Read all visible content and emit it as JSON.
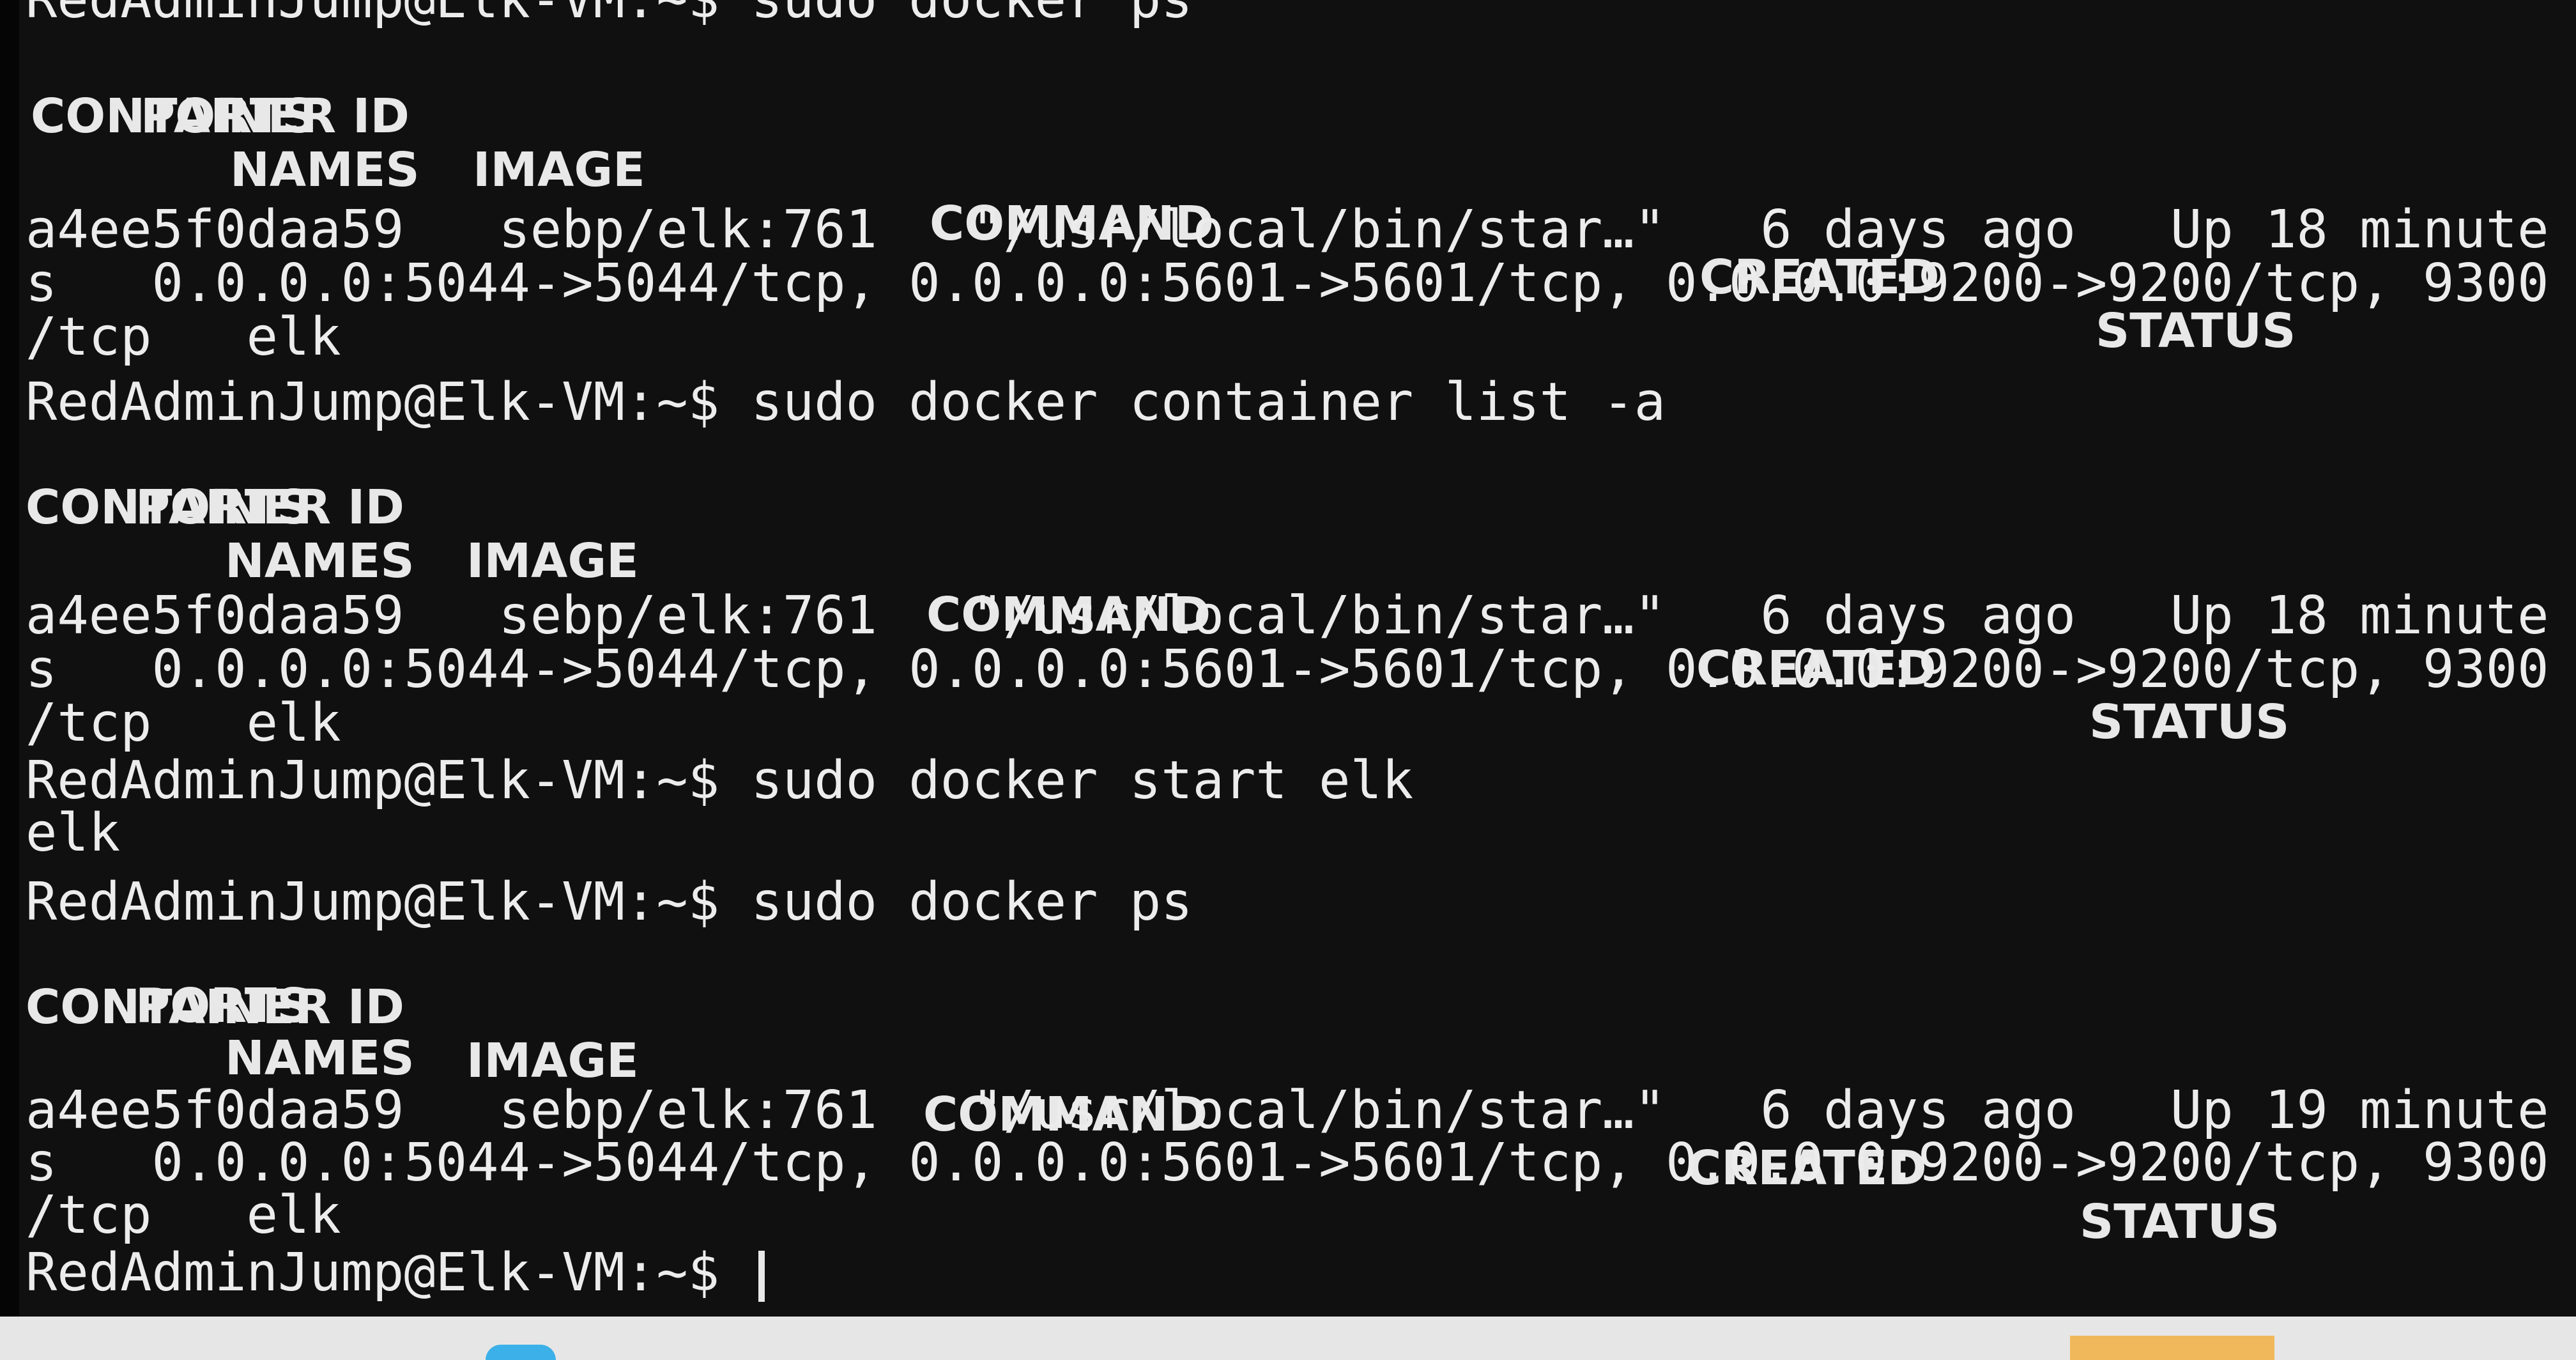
{
  "terminal": {
    "blocks": [
      {
        "prompt": "RedAdminJump@Elk-VM:~$ ",
        "command": "sudo docker ps",
        "headers": {
          "container_id": "CONTAINER ID",
          "image": "IMAGE",
          "command": "COMMAND",
          "created": "CREATED",
          "status": "STATUS",
          "ports": "PORTS",
          "names": "NAMES"
        },
        "row": {
          "line1": "a4ee5f0daa59   sebp/elk:761   \"/usr/local/bin/star…\"   6 days ago   Up 18 minute",
          "line2": "s   0.0.0.0:5044->5044/tcp, 0.0.0.0:5601->5601/tcp, 0.0.0.0:9200->9200/tcp, 9300",
          "line3": "/tcp   elk"
        }
      },
      {
        "prompt": "RedAdminJump@Elk-VM:~$ ",
        "command": "sudo docker container list -a",
        "headers": {
          "container_id": "CONTAINER ID",
          "image": "IMAGE",
          "command": "COMMAND",
          "created": "CREATED",
          "status": "STATUS",
          "ports": "PORTS",
          "names": "NAMES"
        },
        "row": {
          "line1": "a4ee5f0daa59   sebp/elk:761   \"/usr/local/bin/star…\"   6 days ago   Up 18 minute",
          "line2": "s   0.0.0.0:5044->5044/tcp, 0.0.0.0:5601->5601/tcp, 0.0.0.0:9200->9200/tcp, 9300",
          "line3": "/tcp   elk"
        }
      },
      {
        "prompt": "RedAdminJump@Elk-VM:~$ ",
        "command": "sudo docker start elk",
        "output": "elk"
      },
      {
        "prompt": "RedAdminJump@Elk-VM:~$ ",
        "command": "sudo docker ps",
        "headers": {
          "container_id": "CONTAINER ID",
          "image": "IMAGE",
          "command": "COMMAND",
          "created": "CREATED",
          "status": "STATUS",
          "ports": "PORTS",
          "names": "NAMES"
        },
        "row": {
          "line1": "a4ee5f0daa59   sebp/elk:761   \"/usr/local/bin/star…\"   6 days ago   Up 19 minute",
          "line2": "s   0.0.0.0:5044->5044/tcp, 0.0.0.0:5601->5601/tcp, 0.0.0.0:9200->9200/tcp, 9300",
          "line3": "/tcp   elk"
        }
      }
    ],
    "final_prompt": "RedAdminJump@Elk-VM:~$ "
  },
  "colors": {
    "background": "#101010",
    "text": "#ececec",
    "taskbar": "#e6e6e6"
  }
}
